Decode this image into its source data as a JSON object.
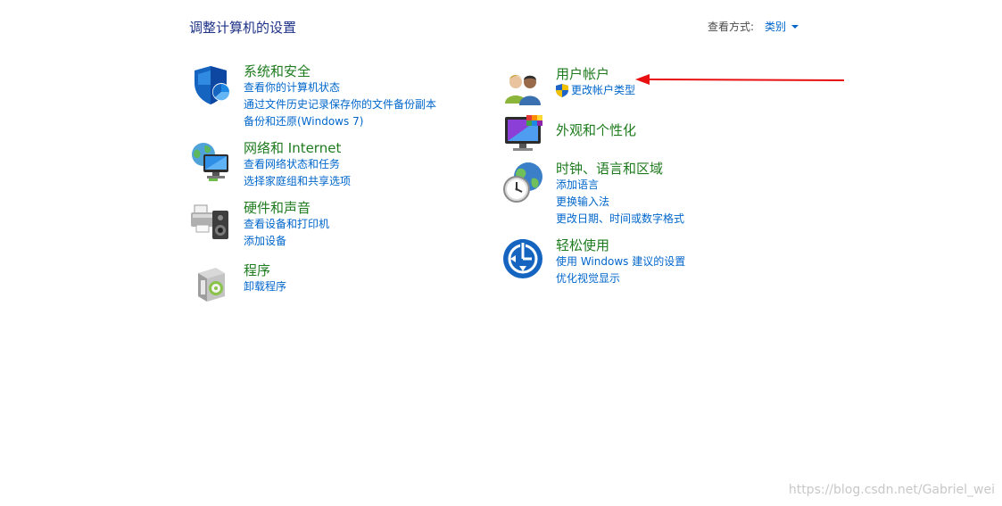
{
  "page": {
    "title": "调整计算机的设置",
    "view_by_label": "查看方式:",
    "view_by_value": "类别"
  },
  "categories": {
    "system_security": {
      "title": "系统和安全",
      "icon": "shield-icon",
      "links": [
        "查看你的计算机状态",
        "通过文件历史记录保存你的文件备份副本",
        "备份和还原(Windows 7)"
      ]
    },
    "network": {
      "title": "网络和 Internet",
      "icon": "network-globe-icon",
      "links": [
        "查看网络状态和任务",
        "选择家庭组和共享选项"
      ]
    },
    "hardware_sound": {
      "title": "硬件和声音",
      "icon": "printer-speaker-icon",
      "links": [
        "查看设备和打印机",
        "添加设备"
      ]
    },
    "programs": {
      "title": "程序",
      "icon": "programs-box-icon",
      "links": [
        "卸载程序"
      ]
    },
    "user_accounts": {
      "title": "用户帐户",
      "icon": "users-icon",
      "links": [
        "更改帐户类型"
      ]
    },
    "appearance": {
      "title": "外观和个性化",
      "icon": "monitor-palette-icon",
      "links": []
    },
    "clock_region": {
      "title": "时钟、语言和区域",
      "icon": "clock-globe-icon",
      "links": [
        "添加语言",
        "更换输入法",
        "更改日期、时间或数字格式"
      ]
    },
    "ease_of_access": {
      "title": "轻松使用",
      "icon": "ease-of-access-icon",
      "links": [
        "使用 Windows 建议的设置",
        "优化视觉显示"
      ]
    }
  },
  "colors": {
    "category_title": "#1e7b1e",
    "link": "#0066cc",
    "page_title": "#1e3287",
    "arrow": "#e81010"
  },
  "watermark": "https://blog.csdn.net/Gabriel_wei"
}
